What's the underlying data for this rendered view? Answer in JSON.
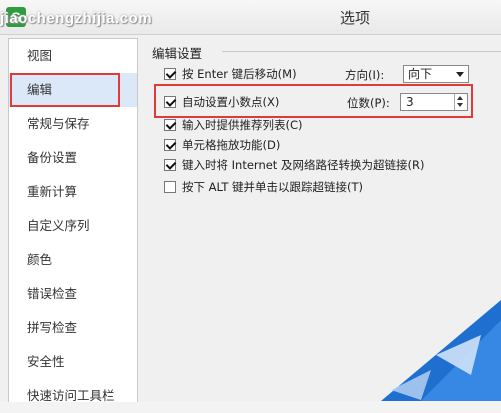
{
  "window": {
    "title": "选项",
    "app_icon": "S",
    "watermark": "jiaochengzhijia.com"
  },
  "sidebar": {
    "items": [
      {
        "label": "视图"
      },
      {
        "label": "编辑",
        "selected": true
      },
      {
        "label": "常规与保存"
      },
      {
        "label": "备份设置"
      },
      {
        "label": "重新计算"
      },
      {
        "label": "自定义序列"
      },
      {
        "label": "颜色"
      },
      {
        "label": "错误检查"
      },
      {
        "label": "拼写检查"
      },
      {
        "label": "安全性"
      },
      {
        "label": "快速访问工具栏"
      }
    ]
  },
  "edit_settings": {
    "section_title": "编辑设置",
    "options": [
      {
        "label": "按 Enter 键后移动(M)",
        "checked": true
      },
      {
        "label": "自动设置小数点(X)",
        "checked": true
      },
      {
        "label": "输入时提供推荐列表(C)",
        "checked": true
      },
      {
        "label": "单元格拖放功能(D)",
        "checked": true
      },
      {
        "label": "键入时将 Internet 及网络路径转换为超链接(R)",
        "checked": true
      },
      {
        "label": "按下 ALT 键并单击以跟踪超链接(T)",
        "checked": false
      }
    ],
    "direction": {
      "label": "方向(I):",
      "value": "向下"
    },
    "decimal_places": {
      "label": "位数(P):",
      "value": "3"
    }
  },
  "colors": {
    "highlight": "#e03a3a",
    "selected_bg": "#dbe8f7",
    "accent_blue": "#1e6fd0"
  }
}
